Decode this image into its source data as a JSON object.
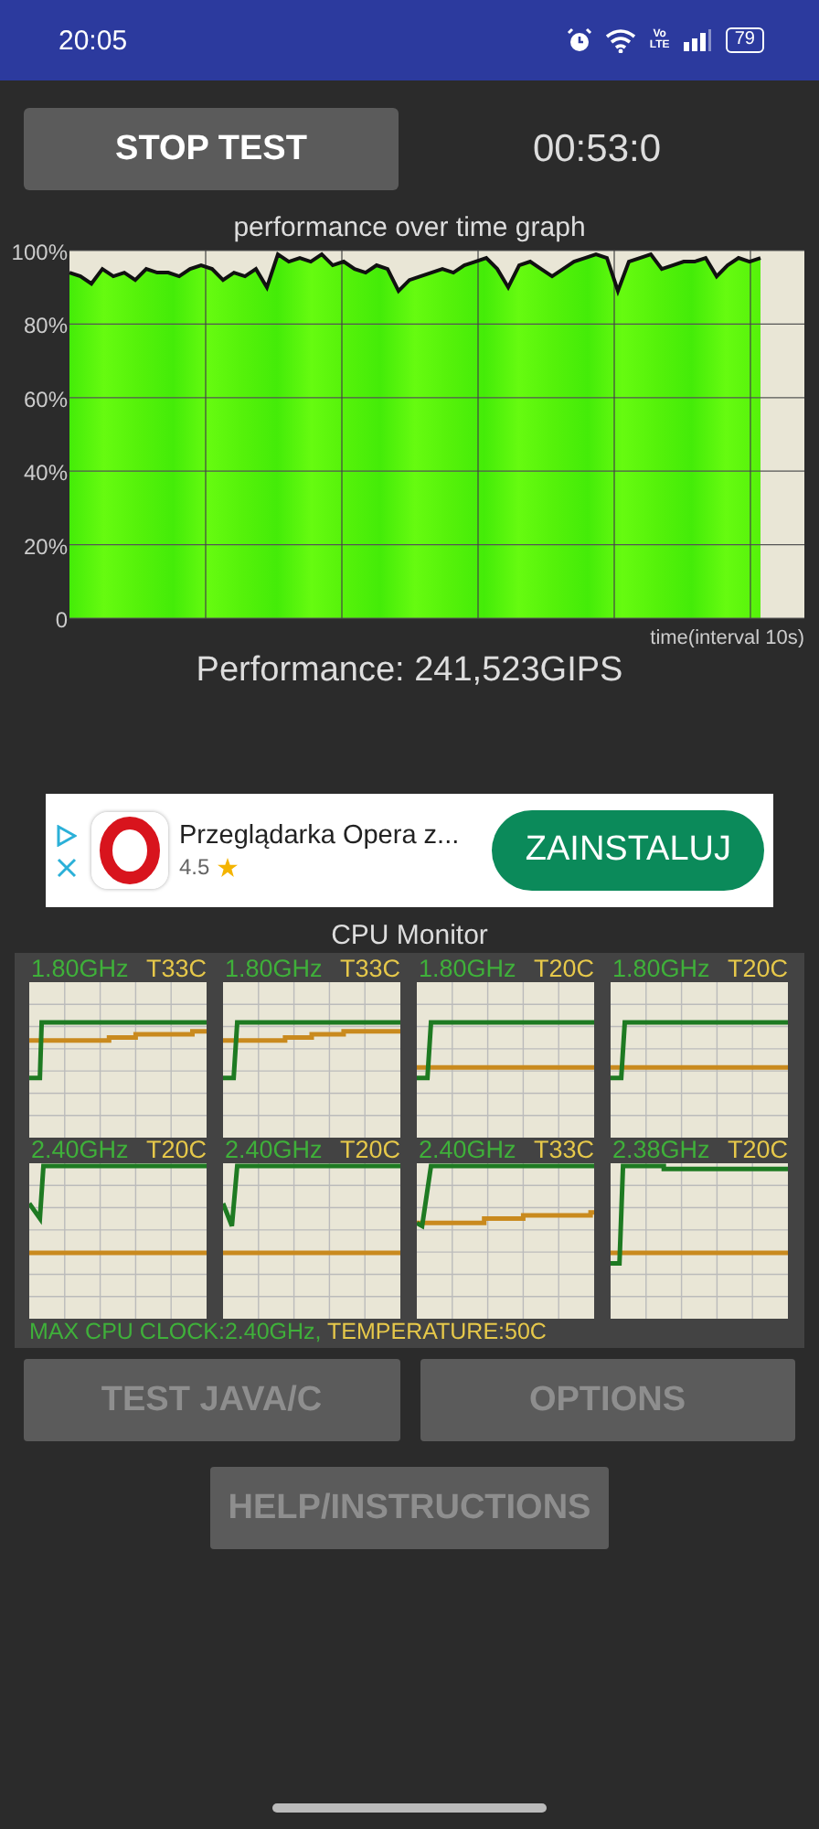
{
  "status_bar": {
    "time": "20:05",
    "network_label": "Vo LTE",
    "battery": "79"
  },
  "controls": {
    "stop_button": "STOP TEST",
    "timer": "00:53:0"
  },
  "graph": {
    "chart_data": {
      "type": "line",
      "title": "performance over time graph",
      "xlabel": "time(interval 10s)",
      "ylim": [
        0,
        100
      ],
      "yticks": [
        {
          "value": 0,
          "label": "0"
        },
        {
          "value": 20,
          "label": "20%"
        },
        {
          "value": 40,
          "label": "40%"
        },
        {
          "value": 60,
          "label": "60%"
        },
        {
          "value": 80,
          "label": "80%"
        },
        {
          "value": 100,
          "label": "100%"
        }
      ],
      "grid": true,
      "series": [
        {
          "color": "#111111",
          "values": [
            94,
            93,
            91,
            95,
            93,
            94,
            92,
            95,
            94,
            94,
            93,
            95,
            96,
            95,
            92,
            94,
            93,
            95,
            90,
            99,
            97,
            98,
            97,
            99,
            96,
            97,
            95,
            94,
            96,
            95,
            89,
            92,
            93,
            94,
            95,
            94,
            96,
            97,
            98,
            95,
            90,
            96,
            97,
            95,
            93,
            95,
            97,
            98,
            99,
            98,
            89,
            97,
            98,
            99,
            95,
            96,
            97,
            97,
            98,
            93,
            96,
            98,
            97,
            98
          ]
        }
      ]
    }
  },
  "performance": "Performance: 241,523GIPS",
  "ad": {
    "title": "Przeglądarka Opera z...",
    "rating": "4.5",
    "button": "ZAINSTALUJ"
  },
  "cpu_monitor": {
    "title": "CPU Monitor",
    "cores": [
      {
        "clock": "1.80GHz",
        "temp": "T33C"
      },
      {
        "clock": "1.80GHz",
        "temp": "T33C"
      },
      {
        "clock": "1.80GHz",
        "temp": "T20C"
      },
      {
        "clock": "1.80GHz",
        "temp": "T20C"
      },
      {
        "clock": "2.40GHz",
        "temp": "T20C"
      },
      {
        "clock": "2.40GHz",
        "temp": "T20C"
      },
      {
        "clock": "2.40GHz",
        "temp": "T33C"
      },
      {
        "clock": "2.38GHz",
        "temp": "T20C"
      }
    ],
    "summary_clock": "MAX CPU CLOCK:2.40GHz,",
    "summary_temp": "TEMPERATURE:50C"
  },
  "buttons": [
    {
      "label": "TEST JAVA/C",
      "disabled": true
    },
    {
      "label": "OPTIONS",
      "disabled": true
    },
    {
      "label": "HELP/INSTRUCTIONS",
      "disabled": true
    }
  ]
}
